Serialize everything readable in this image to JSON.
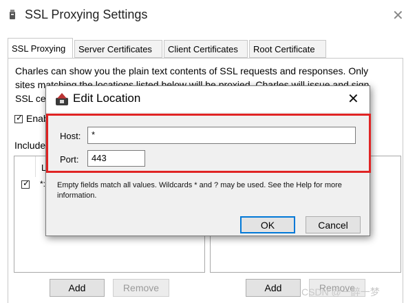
{
  "window": {
    "title": "SSL Proxying Settings",
    "close_glyph": "✕"
  },
  "tabs": [
    {
      "label": "SSL Proxying",
      "active": true
    },
    {
      "label": "Server Certificates",
      "active": false
    },
    {
      "label": "Client Certificates",
      "active": false
    },
    {
      "label": "Root Certificate",
      "active": false
    }
  ],
  "panel": {
    "desc_line1": "Charles can show you the plain text contents of SSL requests and responses. Only",
    "desc_line2": "sites matching the locations listed below will be proxied. Charles will issue and sign",
    "desc_line3": "SSL cer",
    "enable_label": "Enab",
    "include_label": "Include",
    "include_col_header": "L",
    "include_row_text": "*:",
    "include_row_checked": true,
    "left_add_label": "Add",
    "left_remove_label": "Remove",
    "right_add_label": "Add",
    "right_remove_label": "Remove"
  },
  "dialog": {
    "title": "Edit Location",
    "close_glyph": "✕",
    "host_label": "Host:",
    "host_value": "*",
    "port_label": "Port:",
    "port_value": "443",
    "note": "Empty fields match all values. Wildcards * and ? may be used. See the Help for more information.",
    "ok_label": "OK",
    "cancel_label": "Cancel"
  },
  "highlight_color": "#e02424",
  "watermark": "CSDN @一醉一梦",
  "icons": [
    "app-icon",
    "charles-pot-icon",
    "close-icon",
    "checkbox-icon"
  ]
}
